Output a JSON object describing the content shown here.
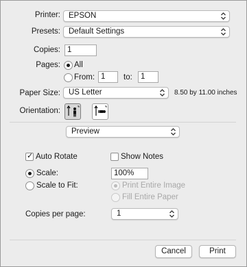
{
  "printer": {
    "label": "Printer:",
    "value": "EPSON"
  },
  "presets": {
    "label": "Presets:",
    "value": "Default Settings"
  },
  "copies": {
    "label": "Copies:",
    "value": "1"
  },
  "pages": {
    "label": "Pages:",
    "all_label": "All",
    "from_label": "From:",
    "from_value": "1",
    "to_label": "to:",
    "to_value": "1"
  },
  "paper_size": {
    "label": "Paper Size:",
    "value": "US Letter",
    "dimensions": "8.50 by 11.00 inches"
  },
  "orientation": {
    "label": "Orientation:",
    "selected": "portrait"
  },
  "section": {
    "value": "Preview"
  },
  "preview_options": {
    "auto_rotate_label": "Auto Rotate",
    "auto_rotate_checked": true,
    "show_notes_label": "Show Notes",
    "show_notes_checked": false,
    "scale_label": "Scale:",
    "scale_value": "100%",
    "scale_to_fit_label": "Scale to Fit:",
    "print_entire_image_label": "Print Entire Image",
    "fill_entire_paper_label": "Fill Entire Paper",
    "copies_per_page_label": "Copies per page:",
    "copies_per_page_value": "1"
  },
  "buttons": {
    "cancel": "Cancel",
    "print": "Print"
  }
}
